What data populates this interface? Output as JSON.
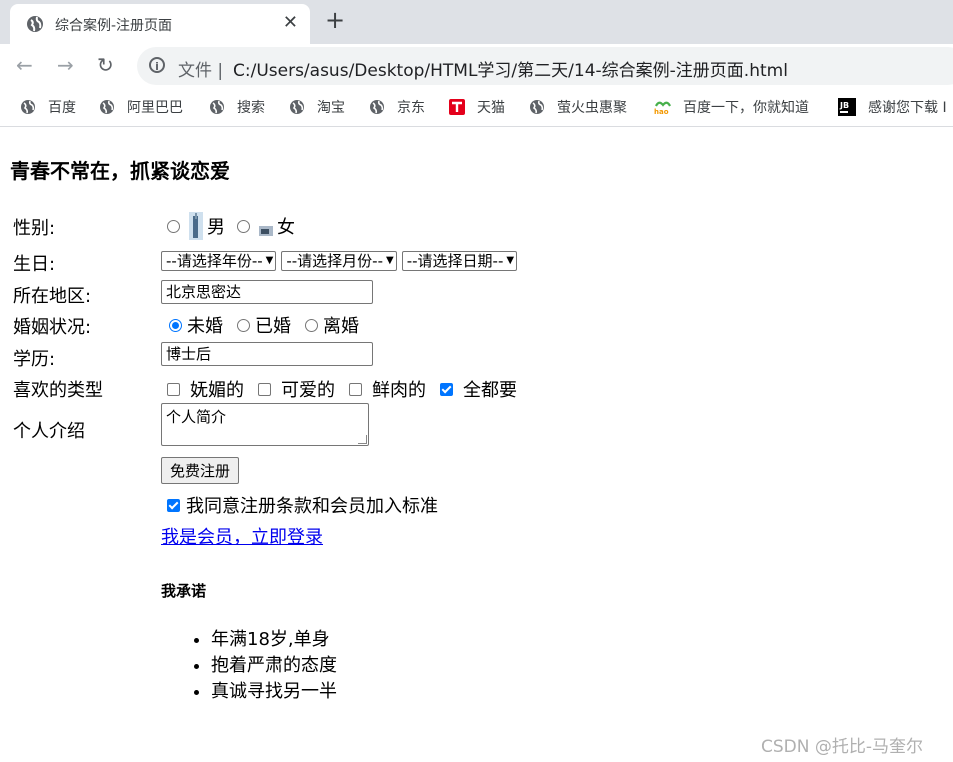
{
  "browser": {
    "tab_title": "综合案例-注册页面",
    "close_glyph": "✕",
    "new_tab_glyph": "+",
    "scheme_label": "文件 |",
    "url": "C:/Users/asus/Desktop/HTML学习/第二天/14-综合案例-注册页面.html",
    "bookmarks": [
      {
        "label": "百度",
        "icon": "globe-icon"
      },
      {
        "label": "阿里巴巴",
        "icon": "globe-icon"
      },
      {
        "label": "搜索",
        "icon": "globe-icon"
      },
      {
        "label": "淘宝",
        "icon": "globe-icon"
      },
      {
        "label": "京东",
        "icon": "globe-icon"
      },
      {
        "label": "天猫",
        "icon": "tmall-icon"
      },
      {
        "label": "萤火虫惠聚",
        "icon": "globe-icon"
      },
      {
        "label": "百度一下，你就知道",
        "icon": "hao-icon"
      },
      {
        "label": "感谢您下载 I",
        "icon": "jb-icon"
      }
    ]
  },
  "page": {
    "heading": "青春不常在，抓紧谈恋爱",
    "gender": {
      "label": "性别:",
      "options": [
        "男",
        "女"
      ]
    },
    "birthday": {
      "label": "生日:",
      "year": "--请选择年份--",
      "month": "--请选择月份--",
      "day": "--请选择日期--"
    },
    "region": {
      "label": "所在地区:",
      "value": "北京思密达"
    },
    "marital": {
      "label": "婚姻状况:",
      "options": [
        "未婚",
        "已婚",
        "离婚"
      ],
      "selected": "未婚"
    },
    "education": {
      "label": "学历:",
      "value": "博士后"
    },
    "types": {
      "label": "喜欢的类型",
      "options": [
        "妩媚的",
        "可爱的",
        "鲜肉的",
        "全都要"
      ],
      "checked": [
        "全都要"
      ]
    },
    "intro": {
      "label": "个人介绍",
      "value": "个人简介"
    },
    "submit_label": "免费注册",
    "agree_label": "我同意注册条款和会员加入标准",
    "login_link": "我是会员，立即登录",
    "promise_title": "我承诺",
    "promises": [
      "年满18岁,单身",
      "抱着严肃的态度",
      "真诚寻找另一半"
    ]
  },
  "watermark": "CSDN @托比-马奎尔"
}
